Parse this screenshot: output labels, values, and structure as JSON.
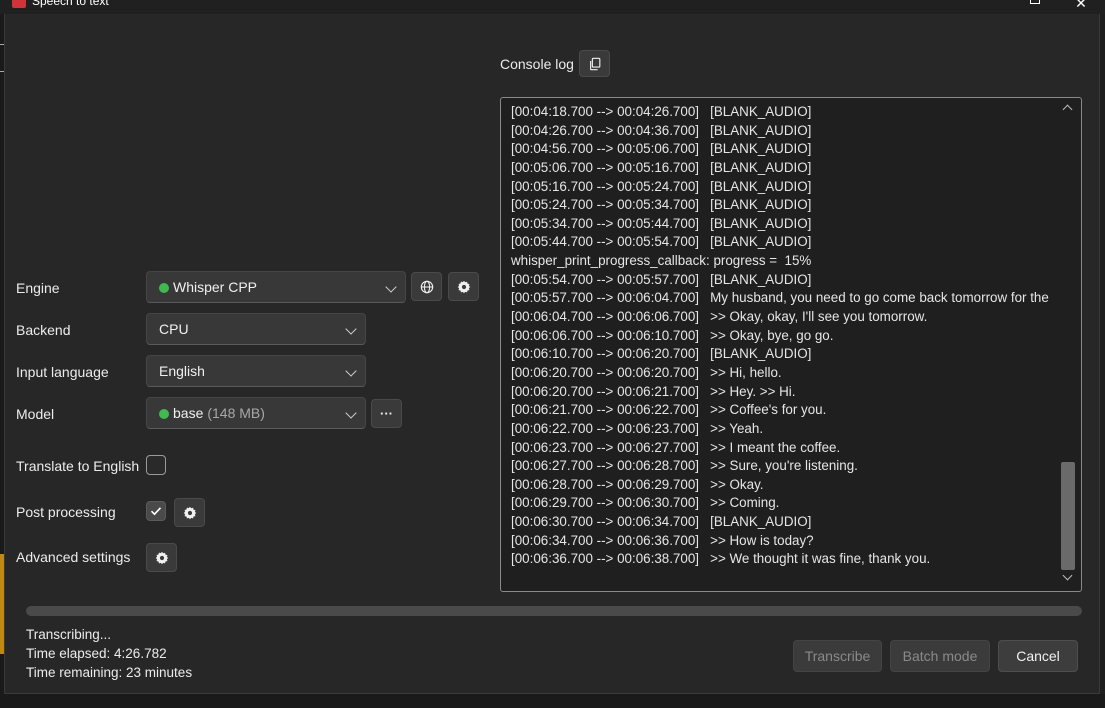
{
  "window": {
    "title": "Speech to text"
  },
  "form": {
    "engine": {
      "label": "Engine",
      "value": "Whisper CPP",
      "status_color": "#3fb950"
    },
    "backend": {
      "label": "Backend",
      "value": "CPU"
    },
    "input_language": {
      "label": "Input language",
      "value": "English"
    },
    "model": {
      "label": "Model",
      "value": "base",
      "size": "(148 MB)",
      "status_color": "#3fb950",
      "more_label": "···"
    },
    "translate": {
      "label": "Translate to English",
      "checked": false
    },
    "post_processing": {
      "label": "Post processing",
      "checked": true
    },
    "advanced": {
      "label": "Advanced settings"
    }
  },
  "console": {
    "label": "Console log",
    "lines": [
      "[00:04:18.700 --> 00:04:26.700]   [BLANK_AUDIO]",
      "[00:04:26.700 --> 00:04:36.700]   [BLANK_AUDIO]",
      "[00:04:56.700 --> 00:05:06.700]   [BLANK_AUDIO]",
      "[00:05:06.700 --> 00:05:16.700]   [BLANK_AUDIO]",
      "[00:05:16.700 --> 00:05:24.700]   [BLANK_AUDIO]",
      "[00:05:24.700 --> 00:05:34.700]   [BLANK_AUDIO]",
      "[00:05:34.700 --> 00:05:44.700]   [BLANK_AUDIO]",
      "[00:05:44.700 --> 00:05:54.700]   [BLANK_AUDIO]",
      "whisper_print_progress_callback: progress =  15%",
      "[00:05:54.700 --> 00:05:57.700]   [BLANK_AUDIO]",
      "[00:05:57.700 --> 00:06:04.700]   My husband, you need to go come back tomorrow for the",
      "[00:06:04.700 --> 00:06:06.700]   >> Okay, okay, I'll see you tomorrow.",
      "[00:06:06.700 --> 00:06:10.700]   >> Okay, bye, go go.",
      "[00:06:10.700 --> 00:06:20.700]   [BLANK_AUDIO]",
      "[00:06:20.700 --> 00:06:20.700]   >> Hi, hello.",
      "[00:06:20.700 --> 00:06:21.700]   >> Hey. >> Hi.",
      "[00:06:21.700 --> 00:06:22.700]   >> Coffee's for you.",
      "[00:06:22.700 --> 00:06:23.700]   >> Yeah.",
      "[00:06:23.700 --> 00:06:27.700]   >> I meant the coffee.",
      "[00:06:27.700 --> 00:06:28.700]   >> Sure, you're listening.",
      "[00:06:28.700 --> 00:06:29.700]   >> Okay.",
      "[00:06:29.700 --> 00:06:30.700]   >> Coming.",
      "[00:06:30.700 --> 00:06:34.700]   [BLANK_AUDIO]",
      "[00:06:34.700 --> 00:06:36.700]   >> How is today?",
      "[00:06:36.700 --> 00:06:38.700]   >> We thought it was fine, thank you."
    ]
  },
  "status": {
    "state": "Transcribing...",
    "elapsed": "Time elapsed: 4:26.782",
    "remaining": "Time remaining: 23 minutes",
    "progress_fraction": 1.0
  },
  "buttons": {
    "transcribe": "Transcribe",
    "batch_mode": "Batch mode",
    "cancel": "Cancel"
  }
}
